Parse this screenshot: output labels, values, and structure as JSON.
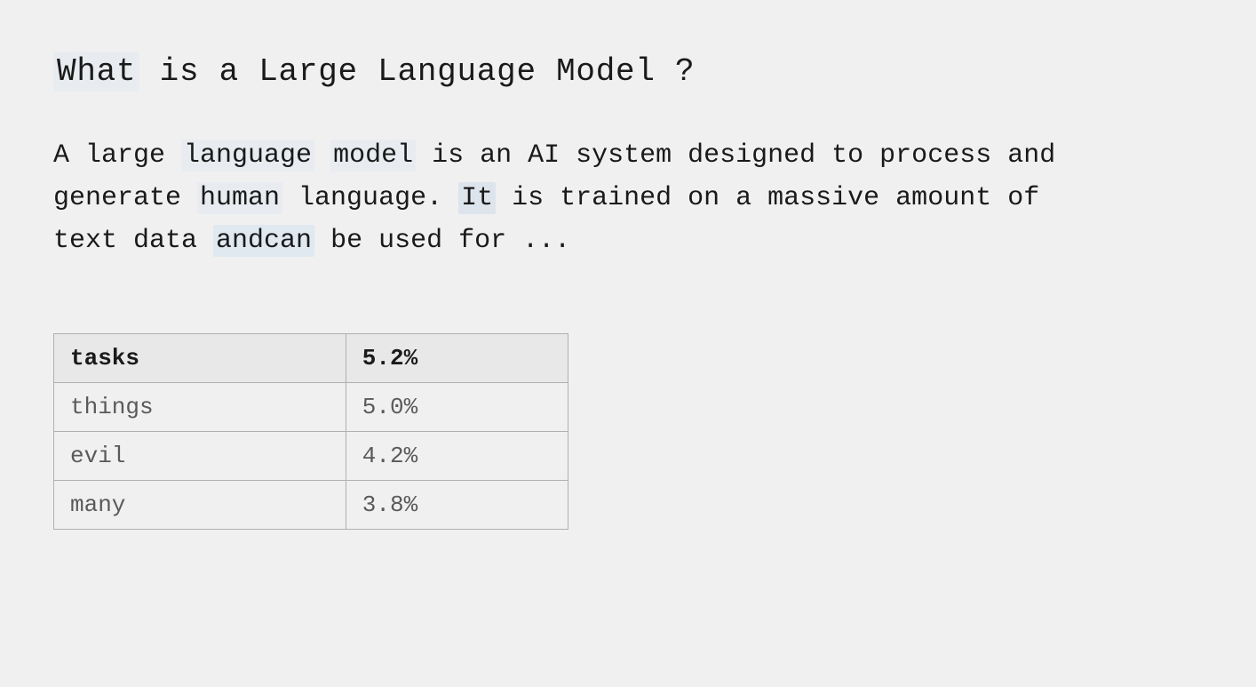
{
  "title": {
    "full": "What is a Large Language Model ?",
    "what": "What",
    "rest": " is a Large Language Model ?"
  },
  "description": {
    "line1_before": "A large ",
    "line1_highlight1": "language",
    "line1_middle1": " ",
    "line1_highlight2": "model",
    "line1_after": " is an AI system designed to process and",
    "line2_before": "generate ",
    "line2_highlight3": "human",
    "line2_middle2": " language.  ",
    "line2_highlight4": "It",
    "line2_after": " is trained on a massive amount of",
    "line3_before": "text data ",
    "line3_highlight5": "andcan",
    "line3_after": " be used for ..."
  },
  "table": {
    "headers": [
      "tasks",
      "5.2%"
    ],
    "rows": [
      {
        "col1": "things",
        "col2": "5.0%"
      },
      {
        "col1": "evil",
        "col2": "4.2%"
      },
      {
        "col1": "many",
        "col2": "3.8%"
      }
    ]
  }
}
